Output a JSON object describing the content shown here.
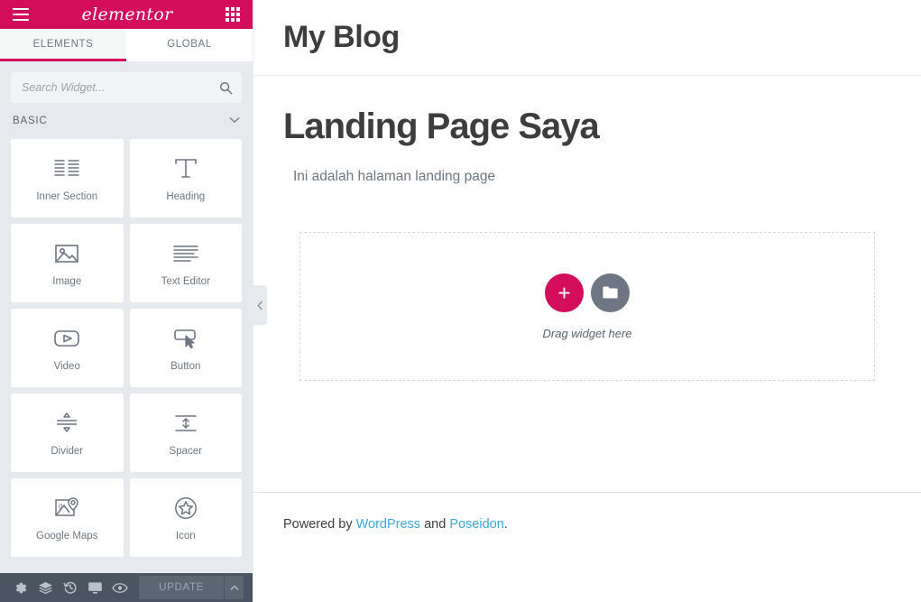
{
  "panel": {
    "header": {
      "menu_icon": "hamburger-icon",
      "logo_text": "elementor",
      "apps_icon": "grid-apps-icon"
    },
    "tabs": [
      {
        "label": "ELEMENTS",
        "active": true
      },
      {
        "label": "GLOBAL",
        "active": false
      }
    ],
    "search": {
      "placeholder": "Search Widget...",
      "value": "",
      "icon": "search-icon"
    },
    "section": {
      "title": "BASIC",
      "chevron": "chevron-down-icon"
    },
    "widgets": [
      {
        "label": "Inner Section",
        "icon": "inner-section-icon"
      },
      {
        "label": "Heading",
        "icon": "heading-t-icon"
      },
      {
        "label": "Image",
        "icon": "image-icon"
      },
      {
        "label": "Text Editor",
        "icon": "text-editor-icon"
      },
      {
        "label": "Video",
        "icon": "video-play-icon"
      },
      {
        "label": "Button",
        "icon": "button-cursor-icon"
      },
      {
        "label": "Divider",
        "icon": "divider-icon"
      },
      {
        "label": "Spacer",
        "icon": "spacer-icon"
      },
      {
        "label": "Google Maps",
        "icon": "google-maps-icon"
      },
      {
        "label": "Icon",
        "icon": "star-circle-icon"
      }
    ],
    "footer": {
      "buttons": [
        {
          "name": "settings-gear-icon"
        },
        {
          "name": "navigator-layers-icon"
        },
        {
          "name": "history-revisions-icon"
        },
        {
          "name": "responsive-mode-icon"
        },
        {
          "name": "preview-eye-icon"
        }
      ],
      "update_label": "UPDATE",
      "caret_icon": "chevron-up-icon"
    },
    "collapse_handle_icon": "chevron-left-icon"
  },
  "preview": {
    "site_title": "My Blog",
    "page_title": "Landing Page Saya",
    "page_subtitle": "Ini adalah halaman landing page",
    "dropzone": {
      "add_icon": "plus-icon",
      "folder_icon": "folder-template-icon",
      "label": "Drag widget here"
    },
    "footer": {
      "prefix": "Powered by ",
      "link1": "WordPress",
      "middle": " and ",
      "link2": "Poseidon",
      "suffix": "."
    }
  },
  "colors": {
    "brand_pink": "#d30c5c",
    "panel_bg": "#e6eaee",
    "toolbar_bg": "#4a5561",
    "link_blue": "#3ba7dd",
    "icon_stroke": "#6d7682"
  }
}
